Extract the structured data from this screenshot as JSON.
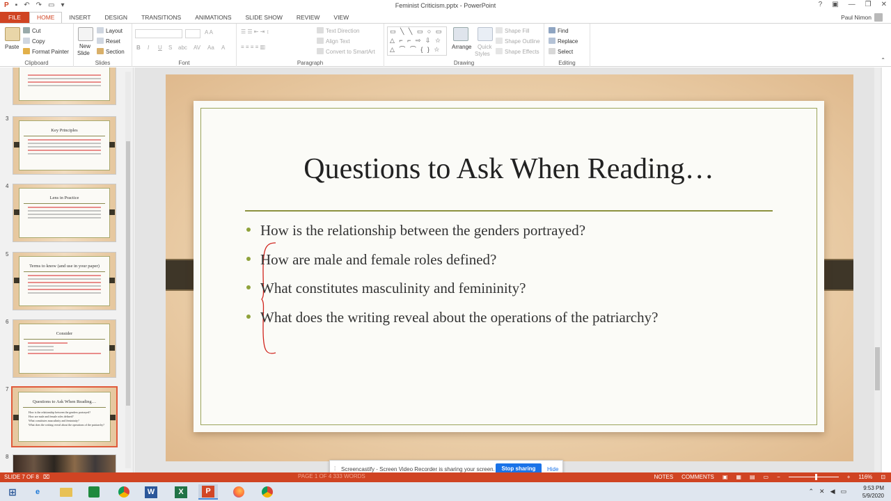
{
  "window": {
    "title": "Feminist Criticism.pptx - PowerPoint",
    "controls": [
      "?",
      "▣",
      "—",
      "❐",
      "✕"
    ]
  },
  "tabs": [
    "FILE",
    "HOME",
    "INSERT",
    "DESIGN",
    "TRANSITIONS",
    "ANIMATIONS",
    "SLIDE SHOW",
    "REVIEW",
    "VIEW"
  ],
  "active_tab": "HOME",
  "user": {
    "name": "Paul Nimon"
  },
  "ribbon": {
    "clipboard": {
      "label": "Clipboard",
      "paste": "Paste",
      "cut": "Cut",
      "copy": "Copy",
      "format_painter": "Format Painter"
    },
    "slides": {
      "label": "Slides",
      "new_slide": "New",
      "new_slide2": "Slide",
      "layout": "Layout",
      "reset": "Reset",
      "section": "Section"
    },
    "font": {
      "label": "Font"
    },
    "paragraph": {
      "label": "Paragraph",
      "text_direction": "Text Direction",
      "align_text": "Align Text",
      "convert": "Convert to SmartArt"
    },
    "drawing": {
      "label": "Drawing",
      "arrange": "Arrange",
      "quick_styles": "Quick",
      "quick_styles2": "Styles",
      "shape_fill": "Shape Fill",
      "shape_outline": "Shape Outline",
      "shape_effects": "Shape Effects"
    },
    "editing": {
      "label": "Editing",
      "find": "Find",
      "replace": "Replace",
      "select": "Select"
    }
  },
  "thumbnails": [
    {
      "num": "",
      "title": ""
    },
    {
      "num": "3",
      "title": "Key Principles"
    },
    {
      "num": "4",
      "title": "Lens in Practice"
    },
    {
      "num": "5",
      "title": "Terms to know (and use in your paper)"
    },
    {
      "num": "6",
      "title": "Consider"
    },
    {
      "num": "7",
      "title": "Questions to Ask When Reading…",
      "bullets": [
        "How is the relationship between the genders portrayed?",
        "How are male and female roles defined?",
        "What constitutes masculinity and femininity?",
        "What does the writing reveal about the operations of the patriarchy?"
      ]
    },
    {
      "num": "8",
      "title": ""
    }
  ],
  "slide": {
    "title": "Questions to Ask When Reading…",
    "bullets": [
      "How is the relationship between the genders portrayed?",
      "How are male and female roles defined?",
      "What constitutes masculinity and femininity?",
      "What does the writing reveal about the operations of the patriarchy?"
    ]
  },
  "share_bar": {
    "message": "Screencastify - Screen Video Recorder is sharing your screen.",
    "stop": "Stop sharing",
    "hide": "Hide"
  },
  "status": {
    "slide_info": "SLIDE 7 OF 8",
    "notes": "NOTES",
    "comments": "COMMENTS",
    "zoom": "116%",
    "hidden_text": "PAGE 1 OF 4   333 WORDS"
  },
  "taskbar": {
    "time": "9:53 PM",
    "date": "5/9/2020"
  },
  "colors": {
    "accent": "#d04423",
    "bullet": "#8fa23b",
    "rule": "#8b913f",
    "pen": "#d0221b"
  }
}
